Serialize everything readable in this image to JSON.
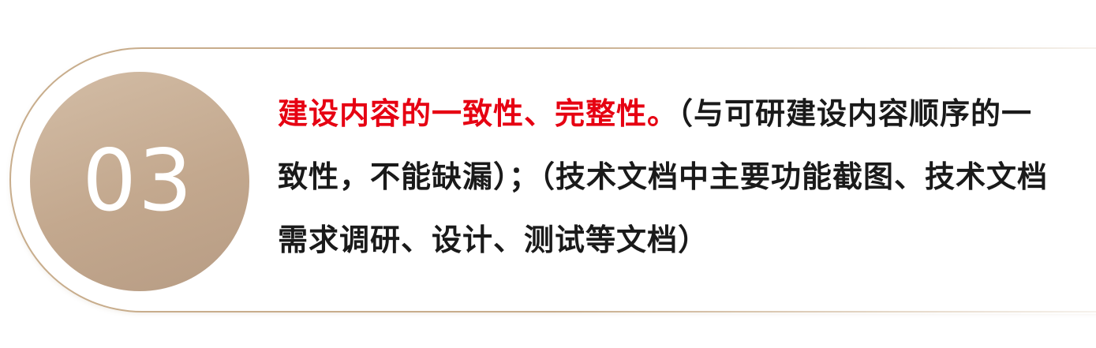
{
  "badge": {
    "number": "03"
  },
  "content": {
    "highlight": "建设内容的一致性、完整性。",
    "body": "（与可研建设内容顺序的一致性，不能缺漏）；（技术文档中主要功能截图、技术文档需求调研、设计、测试等文档）"
  },
  "colors": {
    "highlight": "#e60012",
    "text": "#1a1a1a",
    "badge": "#c3a88e",
    "border": "#c8ad8c"
  }
}
